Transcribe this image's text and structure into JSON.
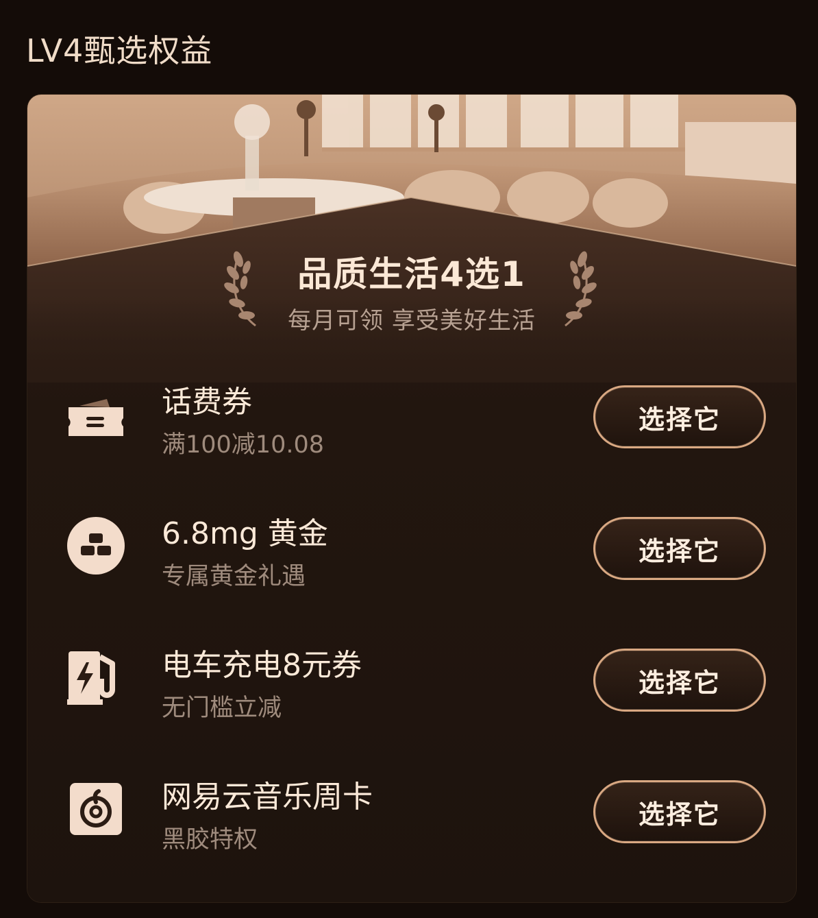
{
  "page": {
    "title": "LV4甄选权益"
  },
  "hero": {
    "title": "品质生活4选1",
    "subtitle": "每月可领 享受美好生活"
  },
  "benefits": [
    {
      "name": "话费券",
      "desc": "满100减10.08",
      "button": "选择它",
      "icon": "ticket-icon"
    },
    {
      "name": "6.8mg 黄金",
      "desc": "专属黄金礼遇",
      "button": "选择它",
      "icon": "gold-bars-icon"
    },
    {
      "name": "电车充电8元券",
      "desc": "无门槛立减",
      "button": "选择它",
      "icon": "ev-charger-icon"
    },
    {
      "name": "网易云音乐周卡",
      "desc": "黑胶特权",
      "button": "选择它",
      "icon": "netease-music-icon"
    }
  ],
  "colors": {
    "accent": "#d9a882",
    "icon_fill": "#f3dccb",
    "background": "#140c08"
  }
}
